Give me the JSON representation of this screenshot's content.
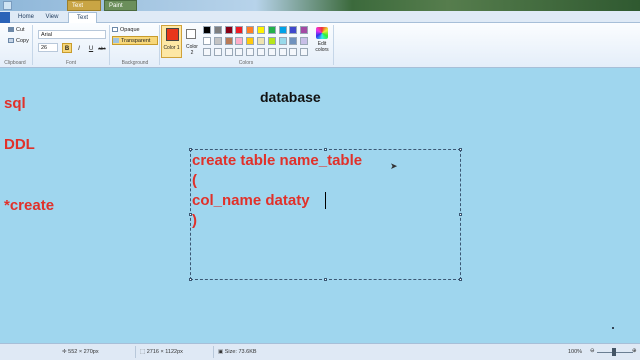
{
  "titlebar": {
    "context_tab": "Text Tools",
    "app_tab": "Paint"
  },
  "tabs": {
    "file": "",
    "home": "Home",
    "view": "View",
    "text": "Text"
  },
  "ribbon": {
    "clipboard": {
      "cut": "Cut",
      "copy": "Copy",
      "group": "Clipboard"
    },
    "font": {
      "family": "Arial",
      "size": "26",
      "bold": "B",
      "italic": "I",
      "underline": "U",
      "strike": "abc",
      "group": "Font"
    },
    "background": {
      "opaque": "Opaque",
      "transparent": "Transparent",
      "group": "Background"
    },
    "color1": "Color 1",
    "color2": "Color 2",
    "colors_group": "Colors",
    "edit_colors": "Edit colors",
    "palette_row1": [
      "#000000",
      "#7f7f7f",
      "#880015",
      "#ed1c24",
      "#ff7f27",
      "#fff200",
      "#22b14c",
      "#00a2e8",
      "#3f48cc",
      "#a349a4"
    ],
    "palette_row2": [
      "#ffffff",
      "#c3c3c3",
      "#b97a57",
      "#ffaec9",
      "#ffc90e",
      "#efe4b0",
      "#b5e61d",
      "#99d9ea",
      "#7092be",
      "#c8bfe7"
    ]
  },
  "canvas": {
    "heading": "database",
    "labels": [
      "sql",
      "DDL",
      "*create"
    ],
    "code_lines": [
      "create table name_table",
      "(",
      "col_name dataty",
      ")"
    ]
  },
  "status": {
    "cursor_pos": "552 × 270px",
    "selection_size": "2716 × 1122px",
    "file_size": "Size: 73.6KB",
    "zoom": "100%"
  },
  "colors": {
    "text_red": "#e1312a",
    "canvas_bg": "#9fd6ee"
  }
}
